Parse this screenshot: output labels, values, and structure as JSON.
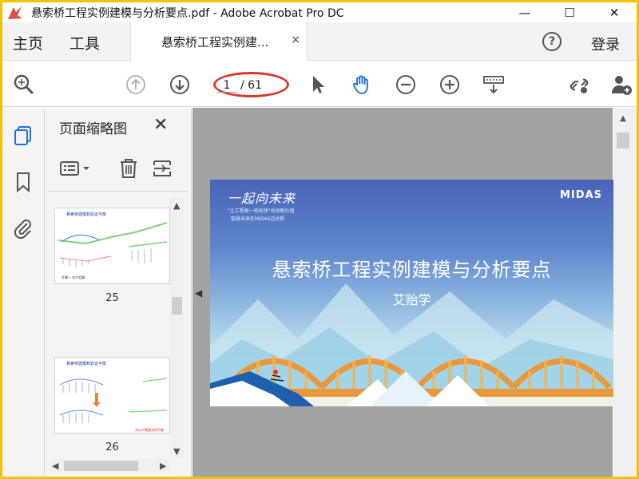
{
  "window": {
    "title": "悬索桥工程实例建模与分析要点.pdf - Adobe Acrobat Pro DC",
    "minimize_glyph": "—",
    "maximize_glyph": "☐",
    "close_glyph": "✕"
  },
  "tabs": {
    "home": "主页",
    "tools": "工具",
    "document": "悬索桥工程实例建...",
    "document_close": "×",
    "help": "?",
    "login": "登录"
  },
  "toolbar": {
    "page_current": "1",
    "page_total": "/ 61",
    "icons": [
      "search-icon",
      "previous-page-icon",
      "next-page-icon",
      "select-cursor-icon",
      "hand-tool-icon",
      "zoom-out-icon",
      "zoom-in-icon",
      "keyboard-tools-icon",
      "share-link-icon",
      "add-user-icon"
    ]
  },
  "sidebar": {
    "rail_icons": [
      "page-thumbnails-icon",
      "bookmark-icon",
      "attachment-icon"
    ],
    "panel_title": "页面缩略图",
    "panel_close": "✕",
    "thumbnails": [
      {
        "page": "25",
        "heading": "悬索桥建模和验证平衡"
      },
      {
        "page": "26",
        "heading": "悬索桥建模和验证平衡"
      }
    ]
  },
  "slide": {
    "logo_text": "一起向未来",
    "motto_line1": "\"让工程更一轻松快\"共创新价值",
    "motto_line2": "智慧未来在MIDAS迈达斯",
    "brand": "MIDAS",
    "title": "悬索桥工程实例建模与分析要点",
    "author": "艾贻学"
  },
  "colors": {
    "accent_blue": "#1f73d6",
    "highlight_red": "#d43b2f",
    "frame_yellow": "#f2c200"
  }
}
